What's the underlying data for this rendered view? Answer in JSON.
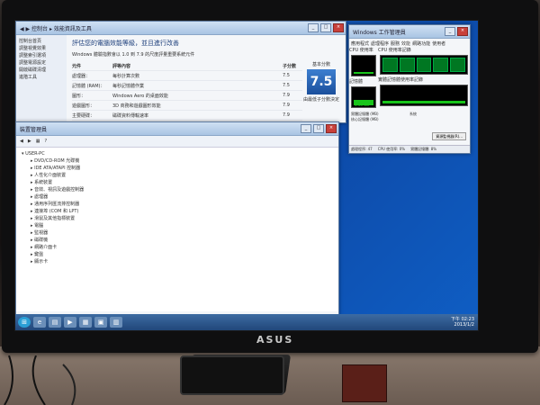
{
  "brand": "ASUS",
  "control_panel": {
    "title": "評估您的電腦效能等級，並且進行改善",
    "desc": "Windows 體驗指數會以 1.0 到 7.9 的尺度評量重要系統元件",
    "col_component": "元件",
    "col_rated": "評等內容",
    "col_subscore": "子分數",
    "col_basescore": "基本分數",
    "rows": [
      {
        "comp": "處理器：",
        "desc": "每秒計算次數",
        "score": "7.5"
      },
      {
        "comp": "記憶體 (RAM)：",
        "desc": "每秒記憶體作業",
        "score": "7.5"
      },
      {
        "comp": "圖形：",
        "desc": "Windows Aero 的桌面效能",
        "score": "7.9"
      },
      {
        "comp": "遊戲圖形：",
        "desc": "3D 商務和遊戲圖形效能",
        "score": "7.9"
      },
      {
        "comp": "主要硬碟：",
        "desc": "磁碟資料傳輸速率",
        "score": "7.9"
      }
    ],
    "base_score": "7.5",
    "base_label": "由最低子分數決定",
    "sidebar": [
      "控制台首頁",
      "調整視覺效果",
      "調整索引選項",
      "調整電源設定",
      "開啟磁碟清理",
      "進階工具"
    ]
  },
  "device_manager": {
    "title": "裝置管理員",
    "root": "USER-PC",
    "items": [
      "DVD/CD-ROM 光碟機",
      "IDE ATA/ATAPI 控制器",
      "人性化介面裝置",
      "系統裝置",
      "音效、視訊及遊戲控制器",
      "處理器",
      "通用序列匯流排控制器",
      "連接埠 (COM 和 LPT)",
      "滑鼠及其他指標裝置",
      "電腦",
      "監視器",
      "磁碟機",
      "網路介面卡",
      "鍵盤",
      "顯示卡"
    ]
  },
  "task_manager": {
    "title": "Windows 工作管理員",
    "tabs": [
      "應用程式",
      "處理程序",
      "服務",
      "效能",
      "網路功能",
      "使用者"
    ],
    "cpu_label": "CPU 使用率",
    "cpu_history": "CPU 使用率記錄",
    "mem_label": "記憶體",
    "mem_value": "1.33 GB",
    "mem_history": "實體記憶體使用率記錄",
    "physical_mem": "實體記憶體 (MB)",
    "kernel_mem": "核心記憶體 (MB)",
    "system": "系統",
    "resource_btn": "資源監視器(R)...",
    "status_processes": "處理程序: 47",
    "status_cpu": "CPU 使用率: 0%",
    "status_mem": "實體記憶體: 8%"
  },
  "taskbar": {
    "time": "下午 02:23",
    "date": "2013/1/2"
  }
}
